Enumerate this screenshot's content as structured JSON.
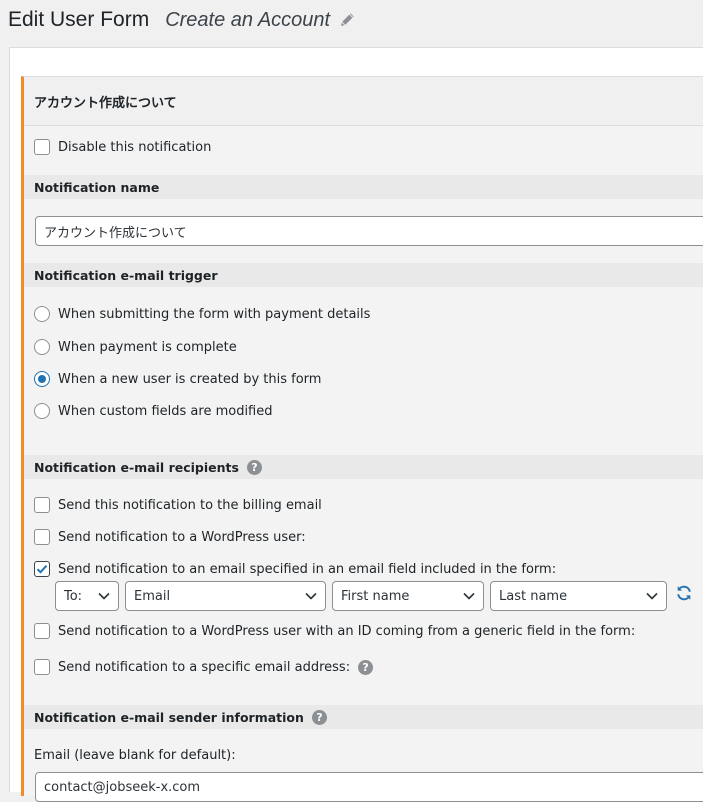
{
  "header": {
    "title": "Edit User Form",
    "subtitle": "Create an Account",
    "edit_icon": "pencil-icon"
  },
  "notification": {
    "box_title": "アカウント作成について",
    "disable_label": "Disable this notification",
    "name_section": "Notification name",
    "name_value": "アカウント作成について",
    "trigger_section": "Notification e-mail trigger",
    "triggers": [
      {
        "label": "When submitting the form with payment details",
        "checked": false
      },
      {
        "label": "When payment is complete",
        "checked": false
      },
      {
        "label": "When a new user is created by this form",
        "checked": true
      },
      {
        "label": "When custom fields are modified",
        "checked": false
      }
    ],
    "recipients_section": "Notification e-mail recipients",
    "recipients": [
      {
        "label": "Send this notification to the billing email",
        "checked": false
      },
      {
        "label": "Send notification to a WordPress user:",
        "checked": false
      },
      {
        "label": "Send notification to an email specified in an email field included in the form:",
        "checked": true
      },
      {
        "label": "Send notification to a WordPress user with an ID coming from a generic field in the form:",
        "checked": false
      },
      {
        "label": "Send notification to a specific email address:",
        "checked": false
      }
    ],
    "recipient_fields": {
      "to": "To:",
      "email": "Email",
      "first_name": "First name",
      "last_name": "Last name"
    },
    "sender_section": "Notification e-mail sender information",
    "sender_email_label": "Email (leave blank for default):",
    "sender_email_value": "contact@jobseek-x.com"
  },
  "colors": {
    "accent": "#f08c28",
    "primary": "#2271b1"
  }
}
